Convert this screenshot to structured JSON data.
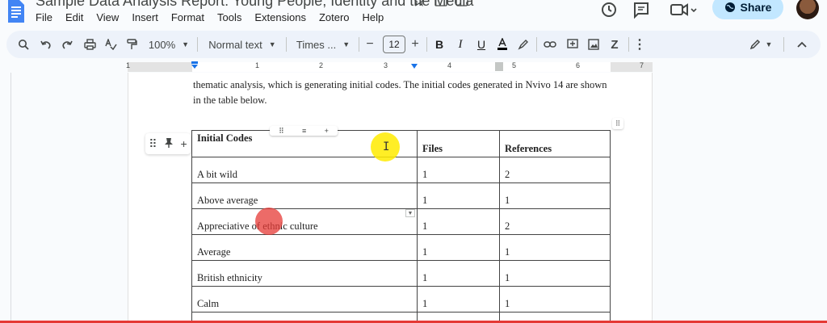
{
  "header": {
    "doc_title": "Sample Data Analysis Report: Young People, Identity and the Media",
    "share_label": "Share",
    "menu": [
      "File",
      "Edit",
      "View",
      "Insert",
      "Format",
      "Tools",
      "Extensions",
      "Zotero",
      "Help"
    ]
  },
  "toolbar": {
    "zoom": "100%",
    "style": "Normal text",
    "font": "Times ...",
    "font_size": "12",
    "text_color": "#000000"
  },
  "ruler": {
    "numbers": [
      "1",
      "1",
      "2",
      "3",
      "4",
      "5",
      "6",
      "7"
    ]
  },
  "document": {
    "paragraph": "thematic analysis, which is generating initial codes. The initial codes generated in Nvivo 14 are shown in the table below.",
    "table": {
      "headers": [
        "Initial Codes",
        "Files",
        "References"
      ],
      "rows": [
        [
          "A bit wild",
          "1",
          "2"
        ],
        [
          "Above average",
          "1",
          "1"
        ],
        [
          "Appreciative of ethnic culture",
          "1",
          "2"
        ],
        [
          "Average",
          "1",
          "1"
        ],
        [
          "British ethnicity",
          "1",
          "1"
        ],
        [
          "Calm",
          "1",
          "1"
        ]
      ]
    }
  },
  "colors": {
    "accent": "#1a73e8",
    "share_bg": "#c2e7ff",
    "cursor_highlight": "#ffeb00",
    "click_marker": "#e53935"
  }
}
